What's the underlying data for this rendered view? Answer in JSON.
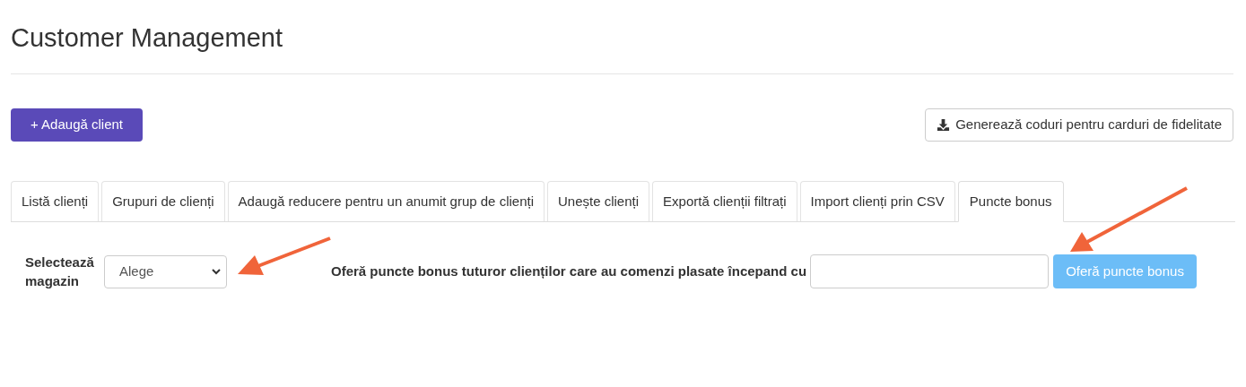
{
  "page_title": "Customer Management",
  "actions": {
    "add_button": {
      "label": "+ Adaugă client"
    },
    "generate_button": {
      "label": "Generează coduri pentru carduri de fidelitate"
    }
  },
  "tabs": [
    {
      "label": "Listă clienți",
      "selected": false
    },
    {
      "label": "Grupuri de clienți",
      "selected": false
    },
    {
      "label": "Adaugă reducere pentru un anumit grup de clienți",
      "selected": false
    },
    {
      "label": "Unește clienți",
      "selected": false
    },
    {
      "label": "Exportă clienții filtrați",
      "selected": false
    },
    {
      "label": "Import clienți prin CSV",
      "selected": false
    },
    {
      "label": "Puncte bonus",
      "selected": true
    }
  ],
  "form": {
    "store_label": "Selectează magazin",
    "store_select": {
      "value": "Alege"
    },
    "date_label": "Oferă puncte bonus tuturor clienților care au comenzi plasate începand cu",
    "submit_button": {
      "label": "Oferă puncte bonus",
      "disabled": true
    }
  }
}
